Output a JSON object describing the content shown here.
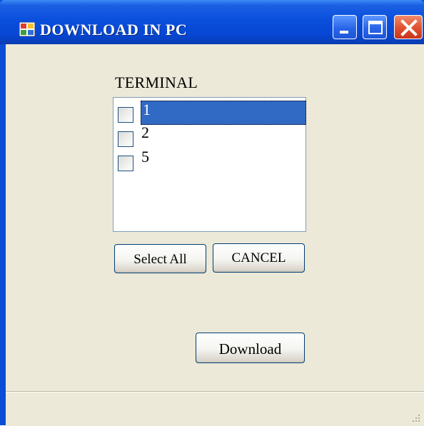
{
  "window": {
    "title": "DOWNLOAD IN PC",
    "controls": {
      "minimize": "minimize-icon",
      "maximize": "maximize-icon",
      "close": "close-icon"
    }
  },
  "form": {
    "terminal_label": "TERMINAL",
    "terminals": [
      {
        "label": "1",
        "checked": false,
        "selected": true
      },
      {
        "label": "2",
        "checked": false,
        "selected": false
      },
      {
        "label": "5",
        "checked": false,
        "selected": false
      }
    ],
    "select_all_label": "Select All",
    "cancel_label": "CANCEL",
    "download_label": "Download"
  },
  "colors": {
    "titlebar": "#0a4fdc",
    "client_bg": "#ece9d8",
    "selection": "#316ac5",
    "close_button": "#e0502e"
  }
}
